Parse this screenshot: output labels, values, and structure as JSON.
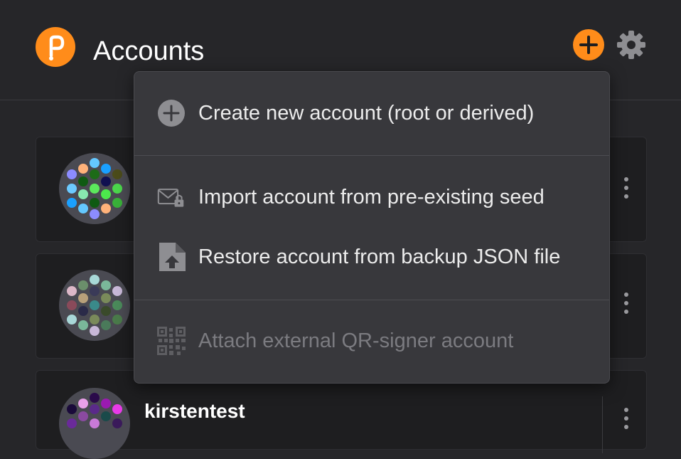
{
  "header": {
    "title": "Accounts",
    "logo_icon": "polkadot-logo-icon",
    "add_icon": "plus-icon",
    "settings_icon": "gear-icon",
    "accent_color": "#ff8c1a"
  },
  "menu": {
    "items": [
      {
        "label": "Create new account (root or derived)",
        "icon": "plus-circle-icon",
        "enabled": true
      },
      {
        "label": "Import account from pre-existing seed",
        "icon": "envelope-lock-icon",
        "enabled": true
      },
      {
        "label": "Restore account from backup JSON file",
        "icon": "file-upload-icon",
        "enabled": true
      },
      {
        "label": "Attach external QR-signer account",
        "icon": "qr-code-icon",
        "enabled": false
      }
    ]
  },
  "accounts": [
    {
      "name": "",
      "icon": "identicon"
    },
    {
      "name": "",
      "icon": "identicon"
    },
    {
      "name": "kirstentest",
      "icon": "identicon"
    }
  ]
}
